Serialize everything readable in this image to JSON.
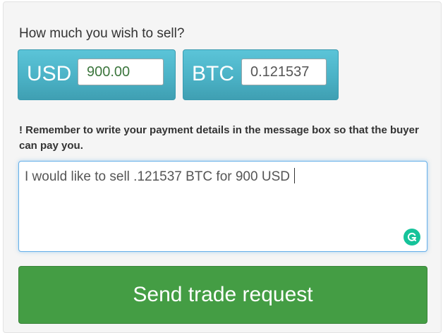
{
  "form": {
    "heading": "How much you wish to sell?",
    "usd": {
      "currency": "USD",
      "amount": "900.00"
    },
    "btc": {
      "currency": "BTC",
      "amount": "0.121537"
    },
    "notice_mark": "!",
    "notice_text": "Remember to write your payment details in the message box so that the buyer can pay you.",
    "message": "I would like to sell .121537 BTC for 900 USD",
    "send_label": "Send trade request"
  },
  "icons": {
    "grammar": "grammarly-icon"
  },
  "colors": {
    "currency_box": "#4bb2c6",
    "send_button": "#449d44",
    "usd_amount_text": "#3c763d",
    "focus_border": "#66afe9",
    "grammar_badge": "#15c39a"
  }
}
